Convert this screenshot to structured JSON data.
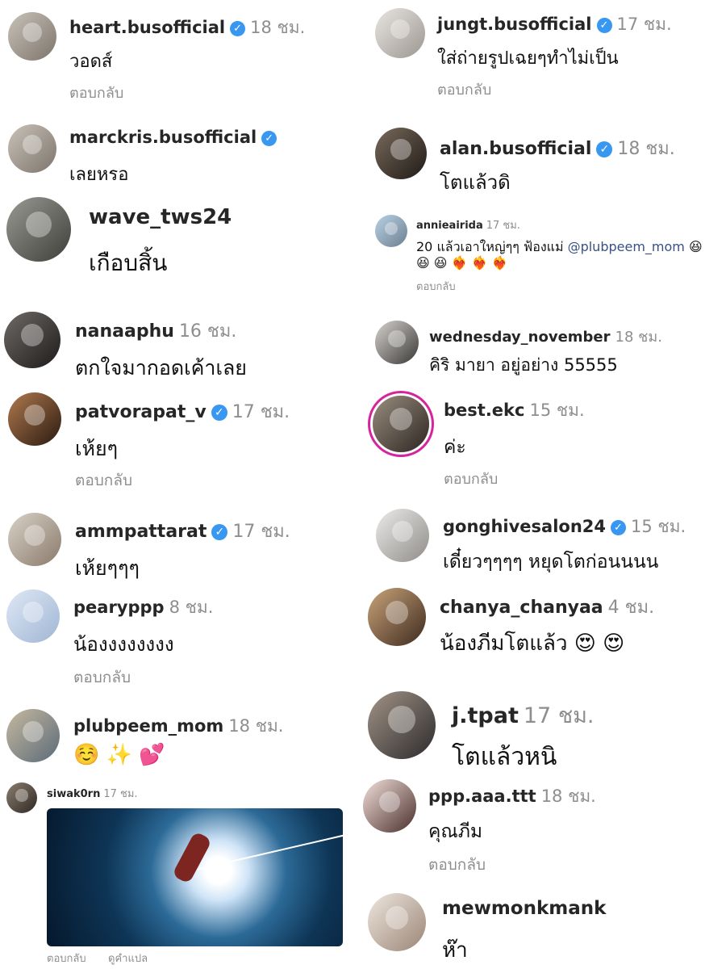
{
  "verified_icon": "verified-check-icon",
  "comments": [
    {
      "username": "heart.busofficial",
      "verified": true,
      "time": "18 ชม.",
      "text": "วอดส์",
      "reply": "ตอบกลับ"
    },
    {
      "username": "marckris.busofficial",
      "verified": true,
      "time": "",
      "text": "เลยหรอ"
    },
    {
      "username": "wave_tws24",
      "verified": false,
      "time": "",
      "text": "เกือบสิ้น"
    },
    {
      "username": "nanaaphu",
      "verified": false,
      "time": "16 ชม.",
      "text": "ตกใจมากอดเค้าเลย"
    },
    {
      "username": "patvorapat_v",
      "verified": true,
      "time": "17 ชม.",
      "text": "เห้ยๆ",
      "reply": "ตอบกลับ"
    },
    {
      "username": "ammpattarat",
      "verified": true,
      "time": "17 ชม.",
      "text": "เห้ยๆๆๆ"
    },
    {
      "username": "pearyppp",
      "verified": false,
      "time": "8 ชม.",
      "text": "น้องงงงงงงง",
      "reply": "ตอบกลับ"
    },
    {
      "username": "plubpeem_mom",
      "verified": false,
      "time": "18 ชม.",
      "text": "☺️ ✨ 💕"
    },
    {
      "username": "siwak0rn",
      "verified": false,
      "time": "17 ชม.",
      "reply": "ตอบกลับ",
      "translate": "ดูคำแปล"
    },
    {
      "username": "jungt.busofficial",
      "verified": true,
      "time": "17 ชม.",
      "text": "ใส่ถ่ายรูปเฉยๆทำไม่เป็น",
      "reply": "ตอบกลับ"
    },
    {
      "username": "alan.busofficial",
      "verified": true,
      "time": "18 ชม.",
      "text": "โตแล้วดิ"
    },
    {
      "username": "annieairida",
      "verified": false,
      "time": "17 ชม.",
      "text_before": "20 แล้วเอาใหญ่ๆๆ ฟ้องแม่ ",
      "mention": "@plubpeem_mom",
      "text_after": " 😆",
      "text_line2": "😆 😆 ❤️‍🔥 ❤️‍🔥 ❤️‍🔥",
      "reply": "ตอบกลับ"
    },
    {
      "username": "wednesday_november",
      "verified": false,
      "time": "18 ชม.",
      "text": "คิริ มายา อยู่อย่าง 55555"
    },
    {
      "username": "best.ekc",
      "verified": false,
      "time": "15 ชม.",
      "text": "ค่ะ",
      "reply": "ตอบกลับ"
    },
    {
      "username": "gonghivesalon24",
      "verified": true,
      "time": "15 ชม.",
      "text": "เดี๋ยวๆๆๆๆ หยุดโตก่อนนนน"
    },
    {
      "username": "chanya_chanyaa",
      "verified": false,
      "time": "4 ชม.",
      "text": "น้องภีมโตแล้ว 😍 😍"
    },
    {
      "username": "j.tpat",
      "verified": false,
      "time": "17 ชม.",
      "text": "โตแล้วหนิ"
    },
    {
      "username": "ppp.aaa.ttt",
      "verified": false,
      "time": "18 ชม.",
      "text": "คุณภีม",
      "reply": "ตอบกลับ"
    },
    {
      "username": "mewmonkmank",
      "verified": false,
      "time": "",
      "text": "ห๊า"
    }
  ]
}
